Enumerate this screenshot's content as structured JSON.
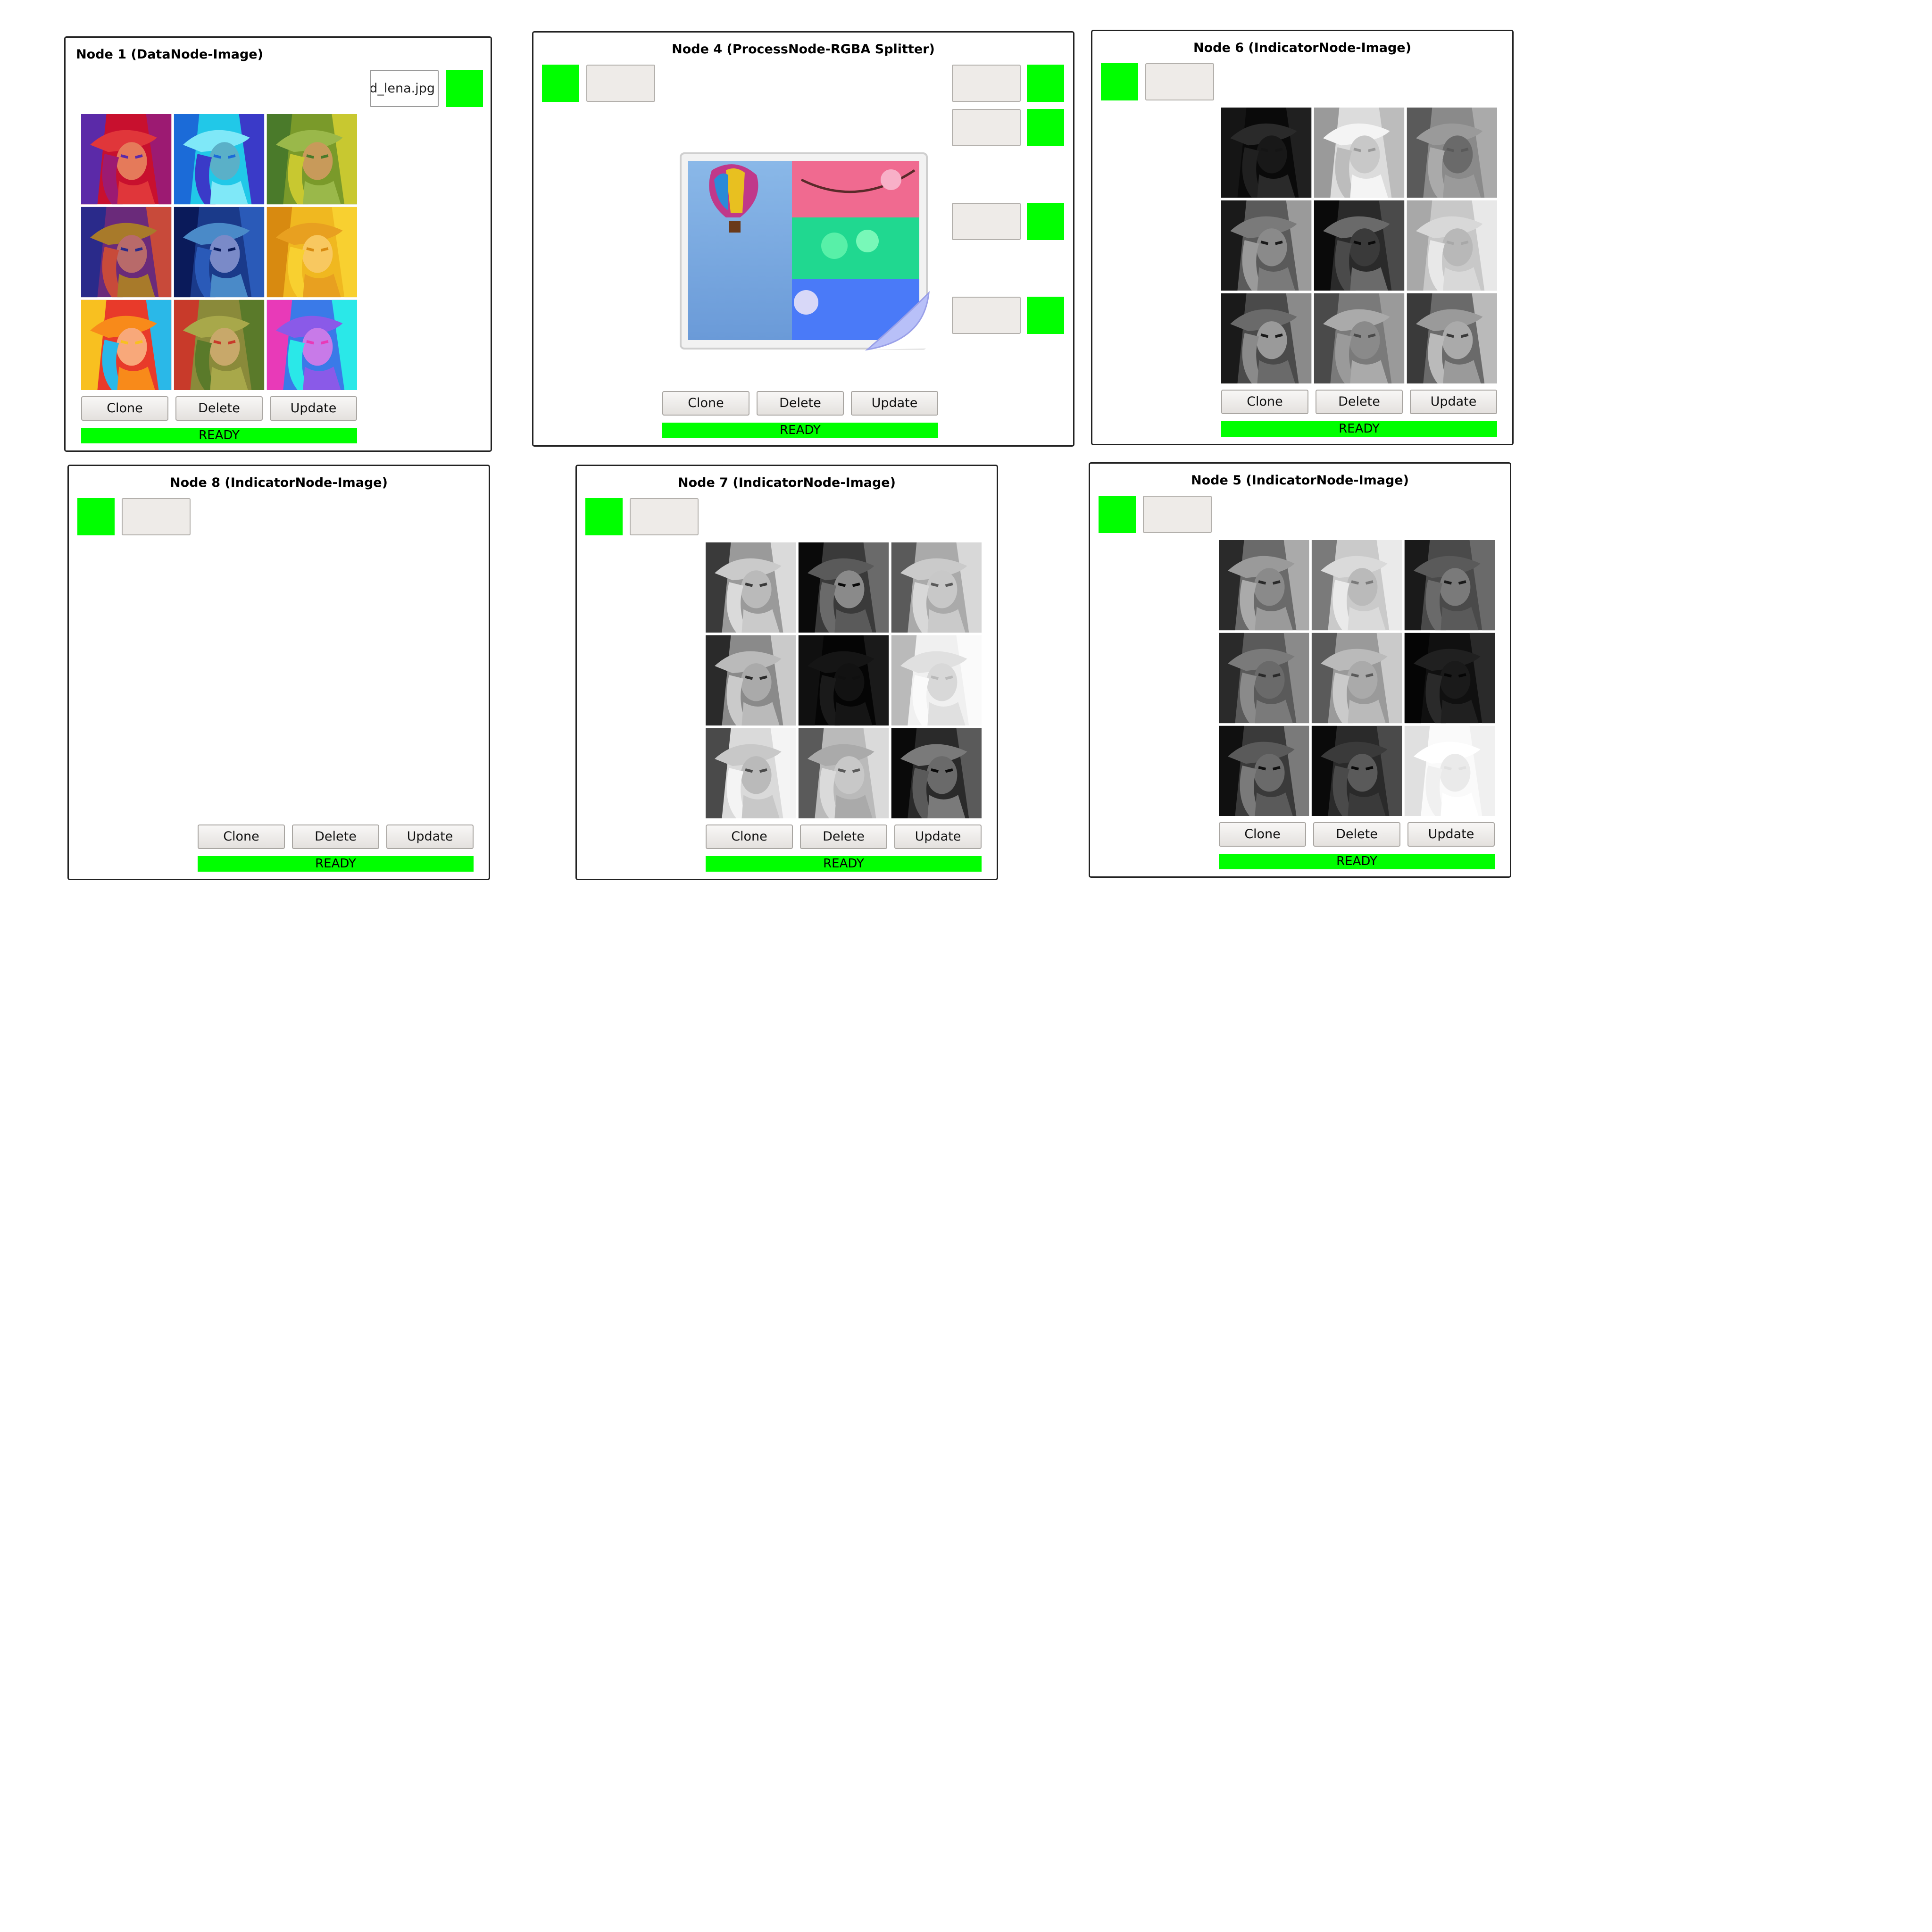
{
  "colors": {
    "port_green": "#00ff00",
    "status_green": "#00ff00",
    "field_bg": "#eeebe8",
    "node_border": "#222222"
  },
  "nodes": [
    {
      "title": "Node 1 (DataNode-Image)",
      "filename": "d_lena.jpg",
      "image": "3x3 color-tinted Lena grid",
      "buttons": {
        "clone": "Clone",
        "delete": "Delete",
        "update": "Update"
      },
      "status": "READY"
    },
    {
      "title": "Node 4 (ProcessNode-RGBA Splitter)",
      "image": "RGBA splitter icon",
      "buttons": {
        "clone": "Clone",
        "delete": "Delete",
        "update": "Update"
      },
      "status": "READY"
    },
    {
      "title": "Node 6 (IndicatorNode-Image)",
      "image": "3x3 grayscale Lena grid",
      "buttons": {
        "clone": "Clone",
        "delete": "Delete",
        "update": "Update"
      },
      "status": "READY"
    },
    {
      "title": "Node 8 (IndicatorNode-Image)",
      "buttons": {
        "clone": "Clone",
        "delete": "Delete",
        "update": "Update"
      },
      "status": "READY"
    },
    {
      "title": "Node 7 (IndicatorNode-Image)",
      "image": "3x3 grayscale Lena grid",
      "buttons": {
        "clone": "Clone",
        "delete": "Delete",
        "update": "Update"
      },
      "status": "READY"
    },
    {
      "title": "Node 5 (IndicatorNode-Image)",
      "image": "3x3 grayscale Lena grid",
      "buttons": {
        "clone": "Clone",
        "delete": "Delete",
        "update": "Update"
      },
      "status": "READY"
    }
  ]
}
